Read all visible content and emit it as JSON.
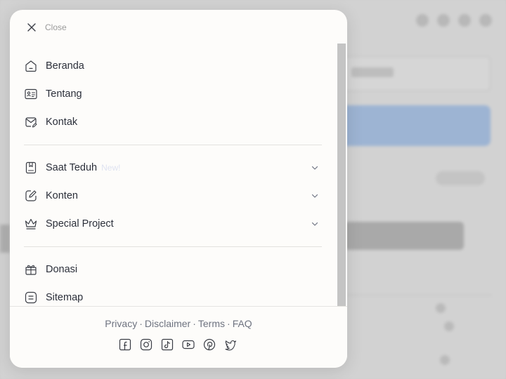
{
  "close": {
    "label": "Close"
  },
  "menu": {
    "primary": [
      {
        "label": "Beranda",
        "icon": "home-icon"
      },
      {
        "label": "Tentang",
        "icon": "id-card-icon"
      },
      {
        "label": "Kontak",
        "icon": "mail-icon"
      }
    ],
    "secondary": [
      {
        "label": "Saat Teduh",
        "badge": "New!",
        "icon": "bookmark-book-icon"
      },
      {
        "label": "Konten",
        "icon": "edit-icon"
      },
      {
        "label": "Special Project",
        "icon": "crown-icon"
      }
    ],
    "tertiary": [
      {
        "label": "Donasi",
        "icon": "gift-icon"
      },
      {
        "label": "Sitemap",
        "icon": "list-icon"
      }
    ]
  },
  "footer": {
    "links": [
      "Privacy",
      "Disclaimer",
      "Terms",
      "FAQ"
    ],
    "separator": "·",
    "socials": [
      "facebook-icon",
      "instagram-icon",
      "tiktok-icon",
      "youtube-icon",
      "pinterest-icon",
      "twitter-icon"
    ]
  },
  "colors": {
    "text": "#2b2f3a",
    "muted": "#6e7380",
    "modal_bg": "#fdfcfa",
    "badge": "#dfe3f1"
  }
}
